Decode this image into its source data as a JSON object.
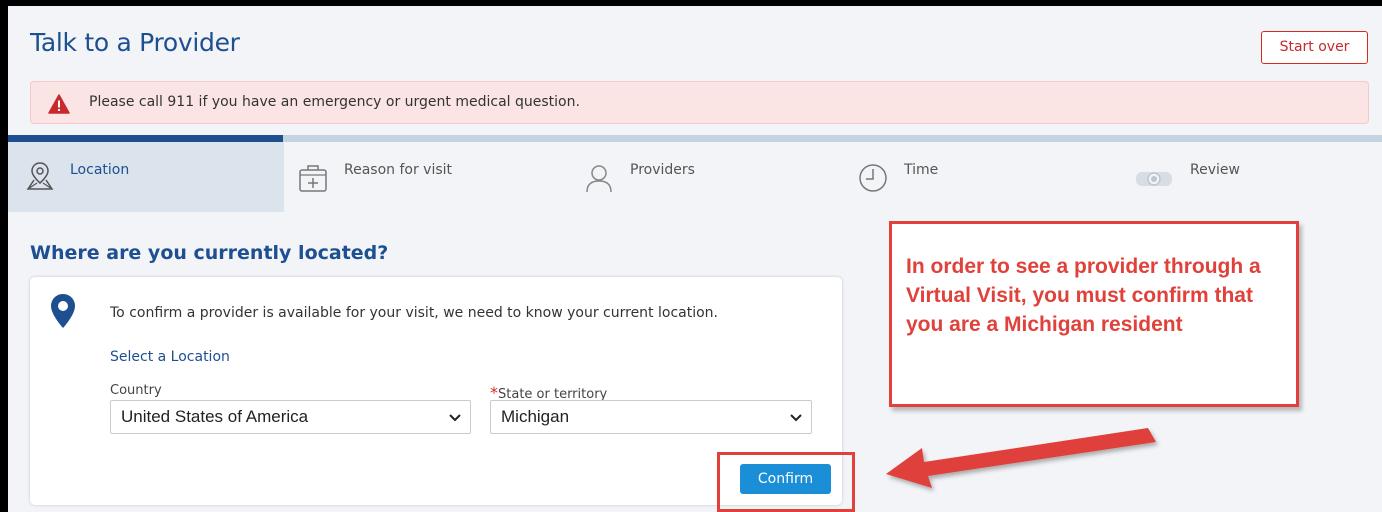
{
  "header": {
    "title": "Talk to a Provider",
    "start_over_label": "Start over"
  },
  "alert": {
    "icon": "warning-triangle-icon",
    "text": "Please call 911 if you have an emergency or urgent medical question."
  },
  "progress": {
    "fraction_complete": 0.2
  },
  "steps": [
    {
      "label": "Location",
      "icon": "map-pin-icon",
      "active": true
    },
    {
      "label": "Reason for visit",
      "icon": "medical-kit-icon",
      "active": false
    },
    {
      "label": "Providers",
      "icon": "user-icon",
      "active": false
    },
    {
      "label": "Time",
      "icon": "clock-icon",
      "active": false
    },
    {
      "label": "Review",
      "icon": "video-camera-icon",
      "active": false
    }
  ],
  "main": {
    "question": "Where are you currently located?",
    "card_text": "To confirm a provider is available for your visit, we need to know your current location.",
    "select_location_label": "Select a Location",
    "country_label": "Country",
    "country_value": "United States of America",
    "state_required_marker": "*",
    "state_label": "State or territory",
    "state_value": "Michigan",
    "confirm_label": "Confirm"
  },
  "annotation": {
    "callout_text": "In order to see a provider through a Virtual Visit, you must confirm that you are a Michigan resident"
  },
  "colors": {
    "brand_blue": "#1d4f91",
    "button_blue": "#1a8fd8",
    "alert_bg": "#fbe4e4",
    "alert_red": "#d52b1e",
    "annotation_red": "#e0413a"
  }
}
